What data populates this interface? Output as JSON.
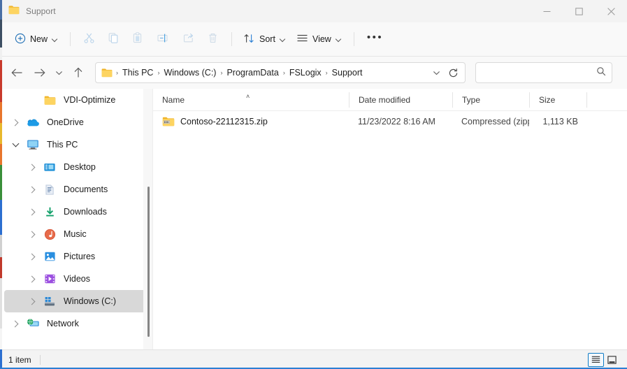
{
  "window": {
    "title": "Support",
    "title_icon": "folder-icon",
    "controls": {
      "minimize": "minimize-icon",
      "maximize": "maximize-icon",
      "close": "close-icon"
    }
  },
  "toolbar": {
    "new_label": "New",
    "new_icon": "plus-circle-icon",
    "cut_icon": "scissors-icon",
    "copy_icon": "copy-icon",
    "paste_icon": "paste-icon",
    "rename_icon": "rename-icon",
    "share_icon": "share-icon",
    "delete_icon": "trash-icon",
    "sort_label": "Sort",
    "sort_icon": "sort-arrows-icon",
    "view_label": "View",
    "view_icon": "lines-icon",
    "more_label": "•••"
  },
  "address": {
    "back_icon": "arrow-left-icon",
    "forward_icon": "arrow-right-icon",
    "recent_icon": "chevron-down-icon",
    "up_icon": "arrow-up-icon",
    "folder_icon": "folder-icon",
    "crumbs": [
      "This PC",
      "Windows (C:)",
      "ProgramData",
      "FSLogix",
      "Support"
    ],
    "separator": "›",
    "dropdown_icon": "chevron-down-icon",
    "refresh_icon": "refresh-icon"
  },
  "search": {
    "value": "",
    "placeholder": "",
    "icon": "search-icon"
  },
  "sidebar": {
    "items": [
      {
        "label": "VDI-Optimize",
        "icon": "folder-icon",
        "indent": 1,
        "expander": "none",
        "selected": false
      },
      {
        "label": "OneDrive",
        "icon": "onedrive-cloud-icon",
        "indent": 0,
        "expander": "collapsed",
        "selected": false
      },
      {
        "label": "This PC",
        "icon": "monitor-icon",
        "indent": 0,
        "expander": "expanded",
        "selected": false
      },
      {
        "label": "Desktop",
        "icon": "desktop-icon",
        "indent": 1,
        "expander": "collapsed",
        "selected": false
      },
      {
        "label": "Documents",
        "icon": "documents-icon",
        "indent": 1,
        "expander": "collapsed",
        "selected": false
      },
      {
        "label": "Downloads",
        "icon": "downloads-icon",
        "indent": 1,
        "expander": "collapsed",
        "selected": false
      },
      {
        "label": "Music",
        "icon": "music-icon",
        "indent": 1,
        "expander": "collapsed",
        "selected": false
      },
      {
        "label": "Pictures",
        "icon": "pictures-icon",
        "indent": 1,
        "expander": "collapsed",
        "selected": false
      },
      {
        "label": "Videos",
        "icon": "videos-icon",
        "indent": 1,
        "expander": "collapsed",
        "selected": false
      },
      {
        "label": "Windows (C:)",
        "icon": "drive-icon",
        "indent": 1,
        "expander": "collapsed",
        "selected": true
      },
      {
        "label": "Network",
        "icon": "network-icon",
        "indent": 0,
        "expander": "collapsed",
        "selected": false
      }
    ]
  },
  "filelist": {
    "columns": [
      "Name",
      "Date modified",
      "Type",
      "Size"
    ],
    "sort_column": "Name",
    "sort_caret": "˄",
    "rows": [
      {
        "name": "Contoso-22112315.zip",
        "icon": "zip-folder-icon",
        "date": "11/23/2022 8:16 AM",
        "type": "Compressed (zipp…",
        "size": "1,113 KB"
      }
    ]
  },
  "statusbar": {
    "count_text": "1 item",
    "details_view_icon": "details-view-icon",
    "large_icons_view_icon": "large-icons-view-icon",
    "active_view": "details-view-icon"
  },
  "colors": {
    "accent": "#2b7fd4",
    "folder_yellow": "#f5c23e",
    "selection_gray": "#d8d8d8",
    "chrome_bg": "#f9f9f9"
  }
}
